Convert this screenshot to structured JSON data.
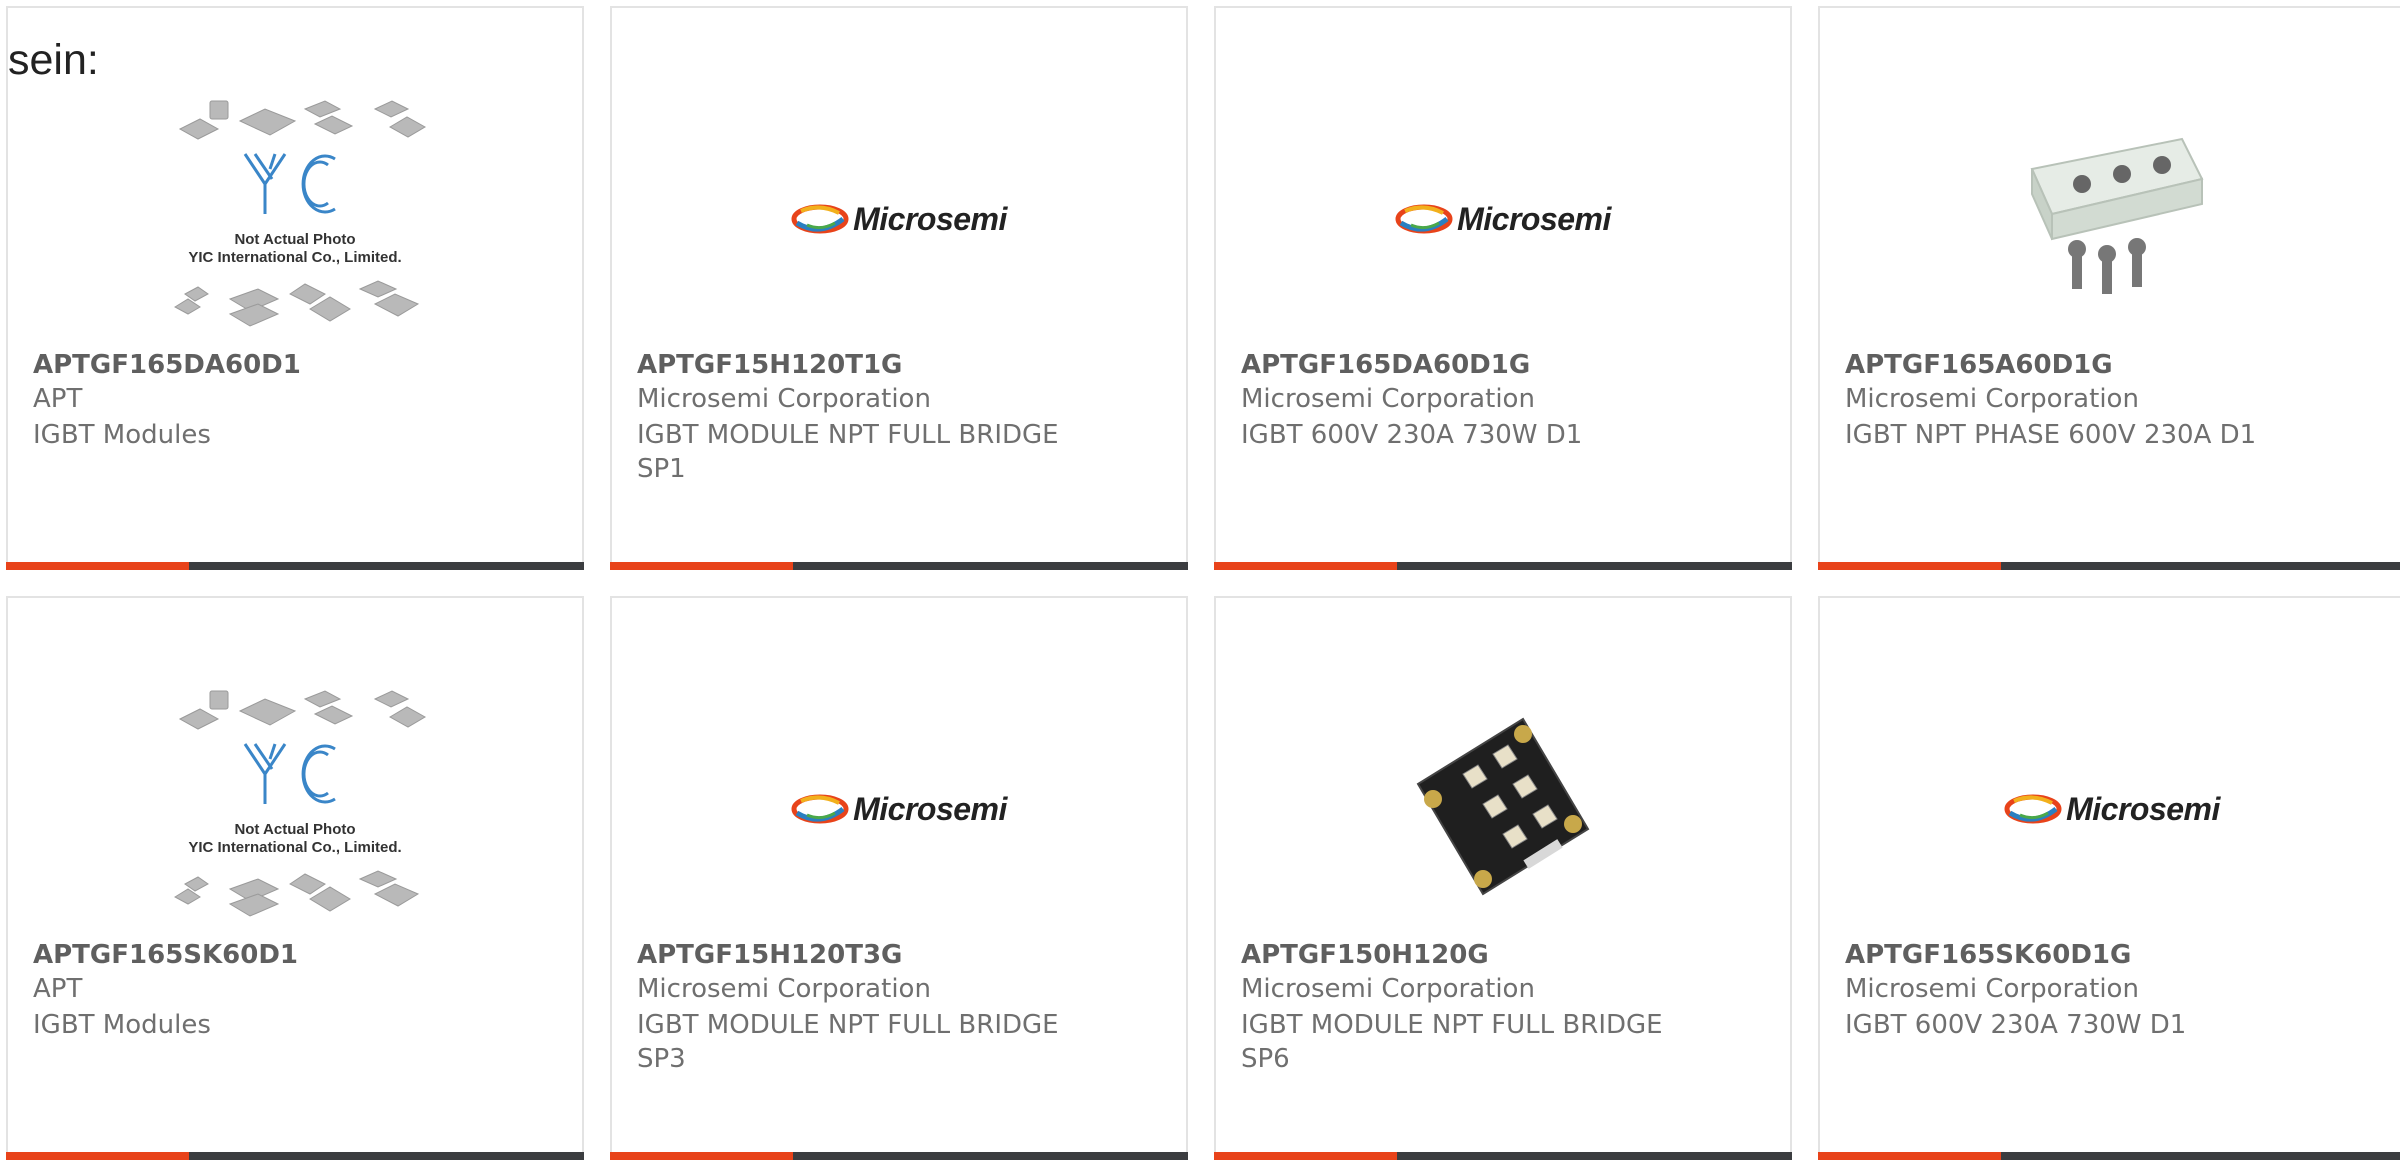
{
  "intro": "sein:",
  "products": [
    {
      "part": "APTGF165DA60D1",
      "manufacturer": "APT",
      "description": "IGBT Modules",
      "image": "yic-placeholder"
    },
    {
      "part": "APTGF15H120T1G",
      "manufacturer": "Microsemi Corporation",
      "description": "IGBT MODULE NPT FULL BRIDGE SP1",
      "image": "microsemi-logo"
    },
    {
      "part": "APTGF165DA60D1G",
      "manufacturer": "Microsemi Corporation",
      "description": "IGBT 600V 230A 730W D1",
      "image": "microsemi-logo"
    },
    {
      "part": "APTGF165A60D1G",
      "manufacturer": "Microsemi Corporation",
      "description": "IGBT NPT PHASE 600V 230A D1",
      "image": "module-white"
    },
    {
      "part": "APTGF165SK60D1",
      "manufacturer": "APT",
      "description": "IGBT Modules",
      "image": "yic-placeholder"
    },
    {
      "part": "APTGF15H120T3G",
      "manufacturer": "Microsemi Corporation",
      "description": "IGBT MODULE NPT FULL BRIDGE SP3",
      "image": "microsemi-logo"
    },
    {
      "part": "APTGF150H120G",
      "manufacturer": "Microsemi Corporation",
      "description": "IGBT MODULE NPT FULL BRIDGE SP6",
      "image": "module-black"
    },
    {
      "part": "APTGF165SK60D1G",
      "manufacturer": "Microsemi Corporation",
      "description": "IGBT 600V 230A 730W D1",
      "image": "microsemi-logo"
    }
  ],
  "yic": {
    "line1": "Not Actual Photo",
    "line2": "YIC International Co., Limited."
  },
  "microsemi": {
    "word": "Microsemi"
  },
  "colors": {
    "accent": "#e8431a",
    "bar": "#3b3d40",
    "border": "#e3e3e3"
  }
}
